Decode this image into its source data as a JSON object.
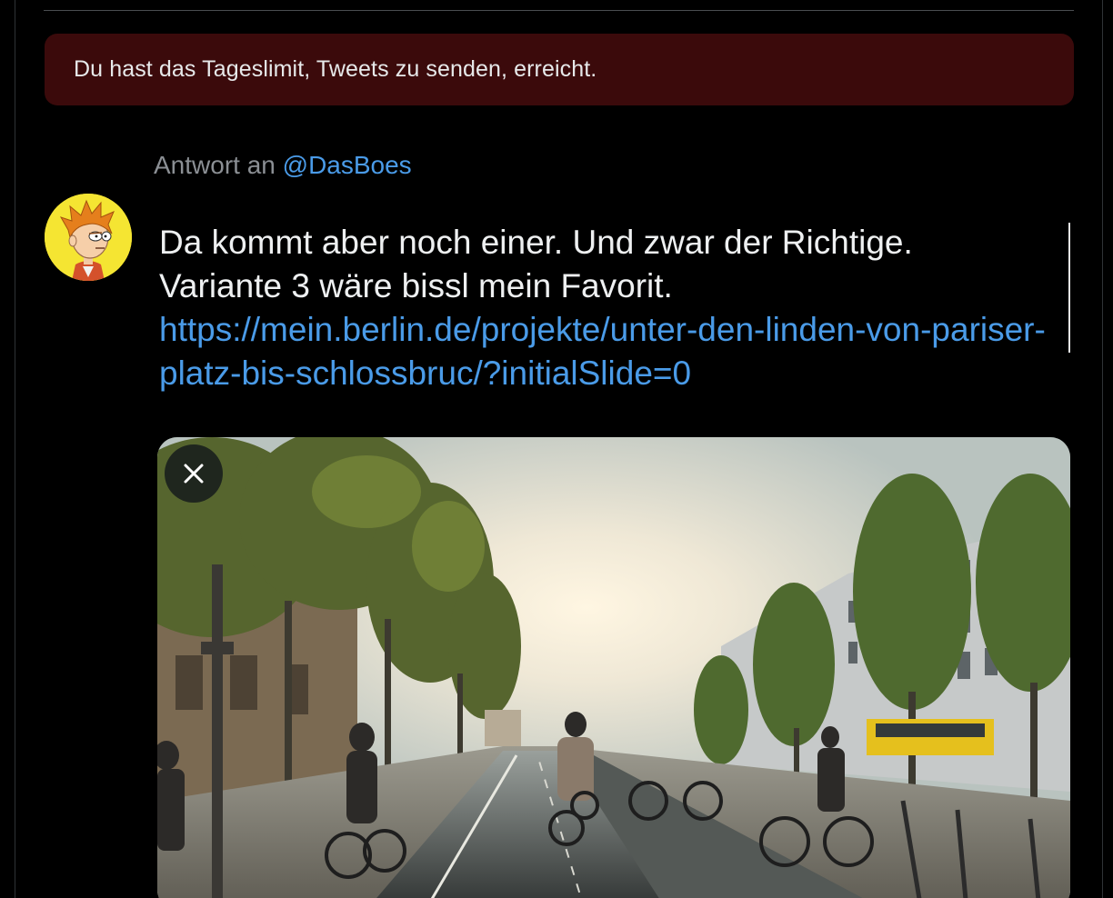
{
  "notice": {
    "text": "Du hast das Tageslimit, Tweets zu senden, erreicht."
  },
  "reply": {
    "prefix": "Antwort an",
    "handle": "@DasBoes"
  },
  "tweet": {
    "line1": "Da kommt aber noch einer. Und zwar der Richtige.",
    "line2": "Variante 3 wäre bissl mein Favorit.",
    "link": "https://mein.berlin.de/projekte/unter-den-linden-von-pariser-platz-bis-schlossbruc/?initialSlide=0"
  },
  "media": {
    "close_icon": "close-icon",
    "image_subject": "street-rendering"
  },
  "colors": {
    "background": "#000000",
    "alert_bg": "#3b0a0b",
    "link": "#4a9be8",
    "muted": "#8b8f94",
    "text": "#e7e9ea"
  }
}
